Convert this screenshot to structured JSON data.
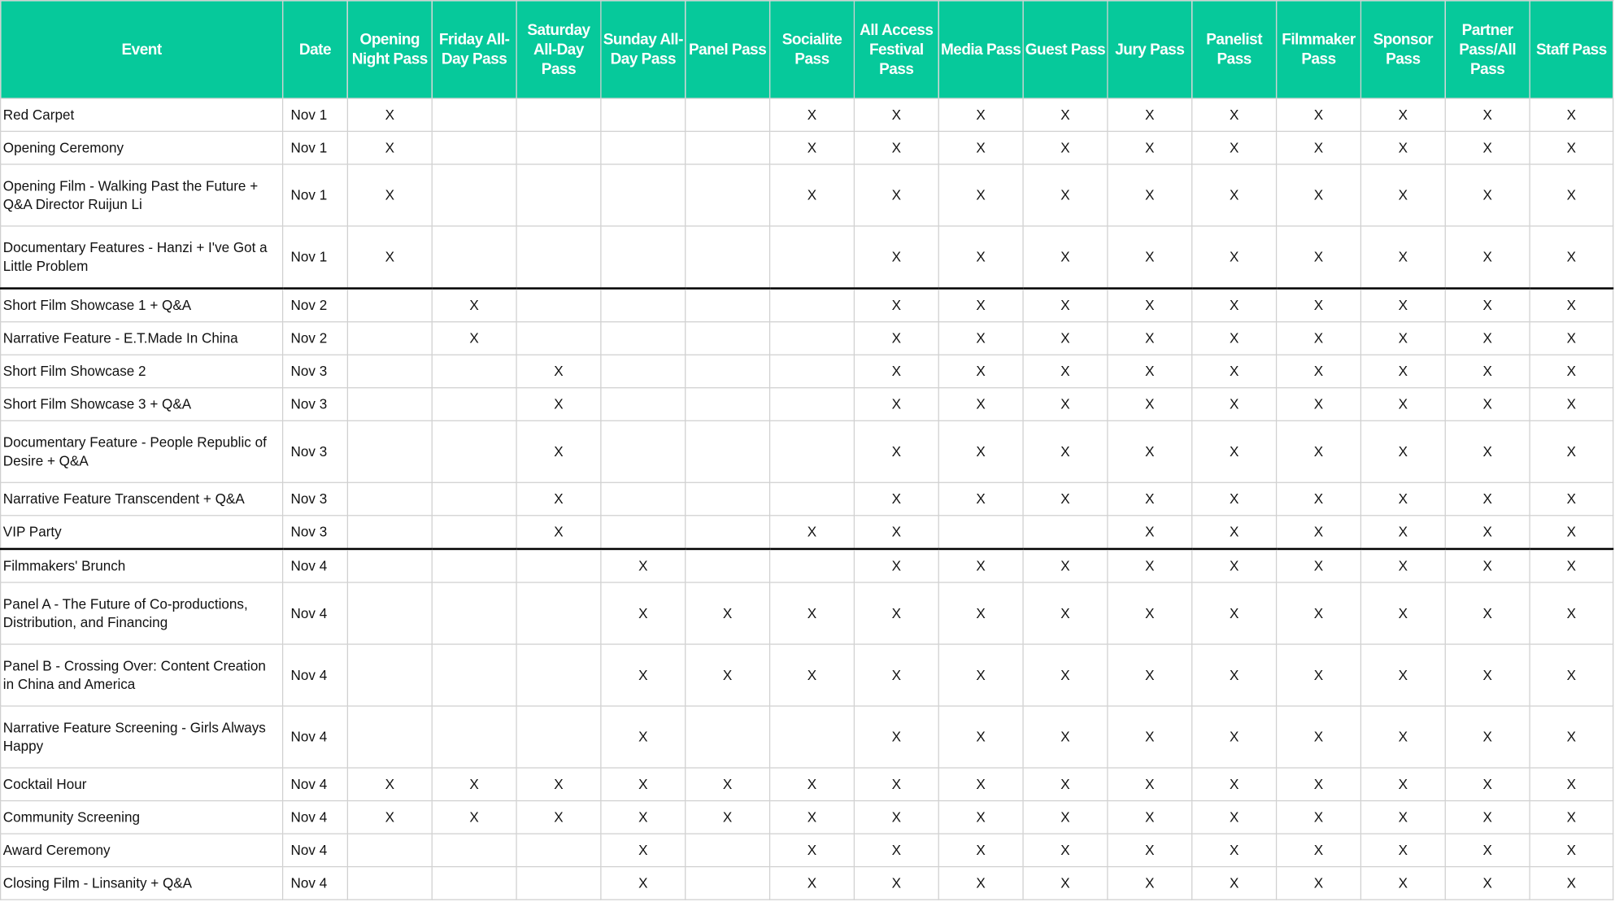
{
  "headers": [
    "Event",
    "Date",
    "Opening Night Pass",
    "Friday All-Day Pass",
    "Saturday All-Day Pass",
    "Sunday All-Day Pass",
    "Panel Pass",
    "Socialite Pass",
    "All Access Festival Pass",
    "Media Pass",
    "Guest Pass",
    "Jury Pass",
    "Panelist Pass",
    "Filmmaker Pass",
    "Sponsor Pass",
    "Partner Pass/All Pass",
    "Staff Pass"
  ],
  "rows": [
    {
      "event": "Red Carpet",
      "date": "Nov 1",
      "marks": [
        "X",
        "",
        "",
        "",
        "",
        "X",
        "X",
        "X",
        "X",
        "X",
        "X",
        "X",
        "X",
        "X",
        "X"
      ]
    },
    {
      "event": "Opening Ceremony",
      "date": "Nov 1",
      "marks": [
        "X",
        "",
        "",
        "",
        "",
        "X",
        "X",
        "X",
        "X",
        "X",
        "X",
        "X",
        "X",
        "X",
        "X"
      ]
    },
    {
      "event": "Opening Film - Walking Past the Future + Q&A Director Ruijun Li",
      "date": "Nov 1",
      "marks": [
        "X",
        "",
        "",
        "",
        "",
        "X",
        "X",
        "X",
        "X",
        "X",
        "X",
        "X",
        "X",
        "X",
        "X"
      ]
    },
    {
      "event": "Documentary Features - Hanzi + I've Got a Little Problem",
      "date": "Nov 1",
      "marks": [
        "X",
        "",
        "",
        "",
        "",
        "",
        "X",
        "X",
        "X",
        "X",
        "X",
        "X",
        "X",
        "X",
        "X"
      ]
    },
    {
      "event": "Short Film Showcase 1 + Q&A",
      "date": "Nov 2",
      "marks": [
        "",
        "X",
        "",
        "",
        "",
        "",
        "X",
        "X",
        "X",
        "X",
        "X",
        "X",
        "X",
        "X",
        "X"
      ]
    },
    {
      "event": "Narrative Feature - E.T.Made In China",
      "date": "Nov 2",
      "marks": [
        "",
        "X",
        "",
        "",
        "",
        "",
        "X",
        "X",
        "X",
        "X",
        "X",
        "X",
        "X",
        "X",
        "X"
      ]
    },
    {
      "event": "Short Film Showcase 2",
      "date": "Nov 3",
      "marks": [
        "",
        "",
        "X",
        "",
        "",
        "",
        "X",
        "X",
        "X",
        "X",
        "X",
        "X",
        "X",
        "X",
        "X"
      ]
    },
    {
      "event": "Short Film Showcase 3 + Q&A",
      "date": "Nov 3",
      "marks": [
        "",
        "",
        "X",
        "",
        "",
        "",
        "X",
        "X",
        "X",
        "X",
        "X",
        "X",
        "X",
        "X",
        "X"
      ]
    },
    {
      "event": "Documentary Feature - People Republic of Desire + Q&A",
      "date": "Nov 3",
      "marks": [
        "",
        "",
        "X",
        "",
        "",
        "",
        "X",
        "X",
        "X",
        "X",
        "X",
        "X",
        "X",
        "X",
        "X"
      ]
    },
    {
      "event": "Narrative Feature Transcendent + Q&A",
      "date": "Nov 3",
      "marks": [
        "",
        "",
        "X",
        "",
        "",
        "",
        "X",
        "X",
        "X",
        "X",
        "X",
        "X",
        "X",
        "X",
        "X"
      ]
    },
    {
      "event": "VIP Party",
      "date": "Nov 3",
      "marks": [
        "",
        "",
        "X",
        "",
        "",
        "X",
        "X",
        "",
        "",
        "X",
        "X",
        "X",
        "X",
        "X",
        "X"
      ]
    },
    {
      "event": "Filmmakers' Brunch",
      "date": "Nov 4",
      "marks": [
        "",
        "",
        "",
        "X",
        "",
        "",
        "X",
        "X",
        "X",
        "X",
        "X",
        "X",
        "X",
        "X",
        "X"
      ]
    },
    {
      "event": "Panel A - The Future of Co-productions, Distribution, and Financing",
      "date": "Nov 4",
      "marks": [
        "",
        "",
        "",
        "X",
        "X",
        "X",
        "X",
        "X",
        "X",
        "X",
        "X",
        "X",
        "X",
        "X",
        "X"
      ]
    },
    {
      "event": "Panel B - Crossing Over: Content Creation in China and America",
      "date": "Nov 4",
      "marks": [
        "",
        "",
        "",
        "X",
        "X",
        "X",
        "X",
        "X",
        "X",
        "X",
        "X",
        "X",
        "X",
        "X",
        "X"
      ]
    },
    {
      "event": "Narrative Feature Screening - Girls Always Happy",
      "date": "Nov 4",
      "marks": [
        "",
        "",
        "",
        "X",
        "",
        "",
        "X",
        "X",
        "X",
        "X",
        "X",
        "X",
        "X",
        "X",
        "X"
      ]
    },
    {
      "event": "Cocktail Hour",
      "date": "Nov 4",
      "marks": [
        "X",
        "X",
        "X",
        "X",
        "X",
        "X",
        "X",
        "X",
        "X",
        "X",
        "X",
        "X",
        "X",
        "X",
        "X"
      ]
    },
    {
      "event": "Community Screening",
      "date": "Nov 4",
      "marks": [
        "X",
        "X",
        "X",
        "X",
        "X",
        "X",
        "X",
        "X",
        "X",
        "X",
        "X",
        "X",
        "X",
        "X",
        "X"
      ]
    },
    {
      "event": "Award Ceremony",
      "date": "Nov 4",
      "marks": [
        "",
        "",
        "",
        "X",
        "",
        "X",
        "X",
        "X",
        "X",
        "X",
        "X",
        "X",
        "X",
        "X",
        "X"
      ]
    },
    {
      "event": "Closing Film - Linsanity + Q&A",
      "date": "Nov 4",
      "marks": [
        "",
        "",
        "",
        "X",
        "",
        "X",
        "X",
        "X",
        "X",
        "X",
        "X",
        "X",
        "X",
        "X",
        "X"
      ]
    }
  ],
  "colors": {
    "header_bg": "#06c99b",
    "header_text": "#ffffff",
    "separator": "#000000",
    "grid": "#d0d0d0"
  }
}
